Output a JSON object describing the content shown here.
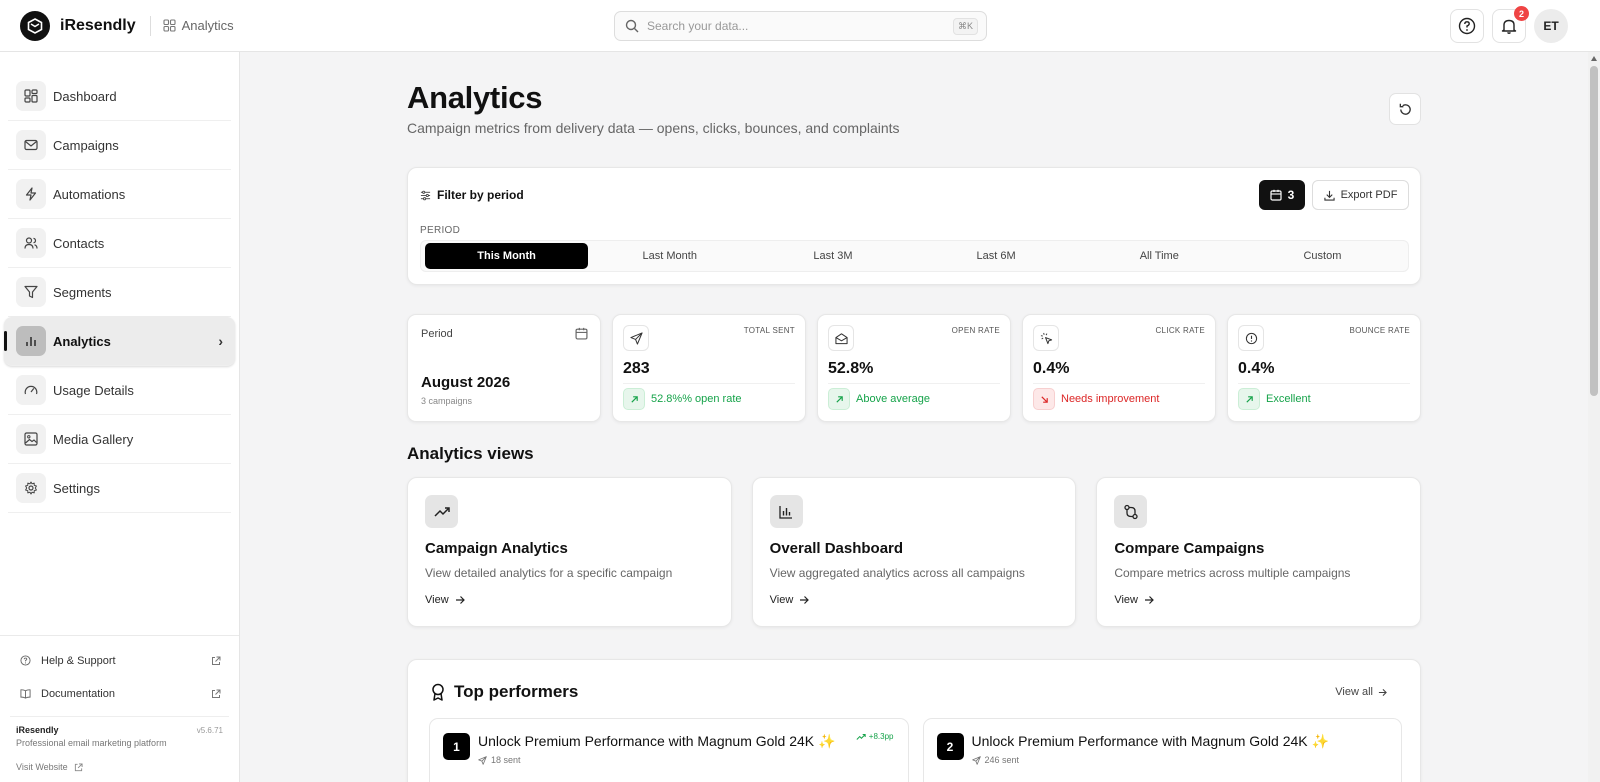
{
  "app": {
    "name": "iResendly",
    "breadcrumb": "Analytics"
  },
  "search": {
    "placeholder": "Search your data...",
    "shortcut": "⌘K"
  },
  "header": {
    "notifications": "2",
    "avatar": "ET"
  },
  "sidebar": {
    "items": [
      {
        "label": "Dashboard"
      },
      {
        "label": "Campaigns"
      },
      {
        "label": "Automations"
      },
      {
        "label": "Contacts"
      },
      {
        "label": "Segments"
      },
      {
        "label": "Analytics"
      },
      {
        "label": "Usage Details"
      },
      {
        "label": "Media Gallery"
      },
      {
        "label": "Settings"
      }
    ],
    "help": "Help & Support",
    "docs": "Documentation",
    "footer_name": "iResendly",
    "footer_tagline": "Professional email marketing platform",
    "version": "v5.6.71",
    "visit": "Visit Website"
  },
  "page": {
    "title": "Analytics",
    "subtitle": "Campaign metrics from delivery data — opens, clicks, bounces, and complaints"
  },
  "filter": {
    "title": "Filter by period",
    "calendar_count": "3",
    "export": "Export PDF",
    "period_label": "PERIOD",
    "tabs": [
      "This Month",
      "Last Month",
      "Last 3M",
      "Last 6M",
      "All Time",
      "Custom"
    ]
  },
  "stats": {
    "period": {
      "label": "Period",
      "value": "August 2026",
      "caption": "3 campaigns"
    },
    "total_sent": {
      "label": "TOTAL SENT",
      "value": "283",
      "trend": "52.8%% open rate"
    },
    "open_rate": {
      "label": "OPEN RATE",
      "value": "52.8%",
      "trend": "Above average"
    },
    "click_rate": {
      "label": "CLICK RATE",
      "value": "0.4%",
      "trend": "Needs improvement"
    },
    "bounce_rate": {
      "label": "BOUNCE RATE",
      "value": "0.4%",
      "trend": "Excellent"
    }
  },
  "views": {
    "title": "Analytics views",
    "cards": [
      {
        "title": "Campaign Analytics",
        "desc": "View detailed analytics for a specific campaign",
        "link": "View"
      },
      {
        "title": "Overall Dashboard",
        "desc": "View aggregated analytics across all campaigns",
        "link": "View"
      },
      {
        "title": "Compare Campaigns",
        "desc": "Compare metrics across multiple campaigns",
        "link": "View"
      }
    ]
  },
  "performers": {
    "title": "Top performers",
    "view_all": "View all",
    "items": [
      {
        "rank": "1",
        "title": "Unlock Premium Performance with Magnum Gold 24K ✨",
        "sent": "18 sent",
        "delta": "+8.3pp"
      },
      {
        "rank": "2",
        "title": "Unlock Premium Performance with Magnum Gold 24K ✨",
        "sent": "246 sent"
      }
    ]
  },
  "colors": {
    "accent": "#111111",
    "positive": "#16a34a",
    "negative": "#dc2626",
    "badge": "#ef4444"
  }
}
